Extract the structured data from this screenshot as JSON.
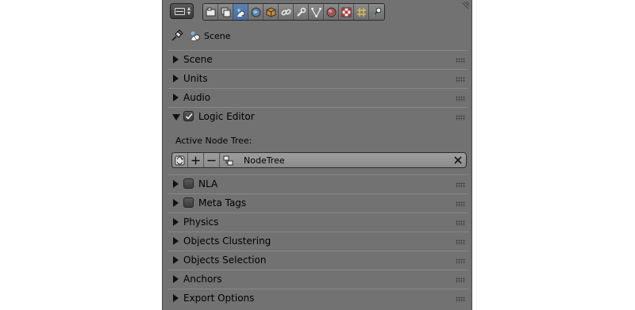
{
  "header": {
    "editor_type_icon": "properties-editor-icon",
    "tabs": [
      {
        "name": "render-tab",
        "icon": "camera-icon",
        "active": false
      },
      {
        "name": "render-layers-tab",
        "icon": "layers-icon",
        "active": false
      },
      {
        "name": "scene-tab",
        "icon": "scene-icon",
        "active": true
      },
      {
        "name": "world-tab",
        "icon": "world-icon",
        "active": false
      },
      {
        "name": "object-tab",
        "icon": "cube-icon",
        "active": false
      },
      {
        "name": "constraints-tab",
        "icon": "chain-icon",
        "active": false
      },
      {
        "name": "modifiers-tab",
        "icon": "wrench-icon",
        "active": false
      },
      {
        "name": "data-tab",
        "icon": "vertex-icon",
        "active": false
      },
      {
        "name": "material-tab",
        "icon": "material-sphere-icon",
        "active": false
      },
      {
        "name": "texture-tab",
        "icon": "checker-icon",
        "active": false
      },
      {
        "name": "particles-tab",
        "icon": "particles-icon",
        "active": false
      },
      {
        "name": "physics-tab",
        "icon": "physics-icon",
        "active": false
      }
    ]
  },
  "context": {
    "label": "Scene"
  },
  "panels": {
    "scene": "Scene",
    "units": "Units",
    "audio": "Audio",
    "logic_editor": "Logic Editor",
    "nla": "NLA",
    "meta_tags": "Meta Tags",
    "physics": "Physics",
    "objects_clustering": "Objects Clustering",
    "objects_selection": "Objects Selection",
    "anchors": "Anchors",
    "export_options": "Export Options"
  },
  "logic_editor": {
    "enabled": true,
    "active_node_tree_label": "Active Node Tree:",
    "node_tree_name": "NodeTree"
  },
  "nla": {
    "enabled": false
  },
  "meta_tags": {
    "enabled": false
  },
  "colors": {
    "panel_bg": "#727272",
    "active_tab": "#5b82b5",
    "text": "#000000"
  }
}
